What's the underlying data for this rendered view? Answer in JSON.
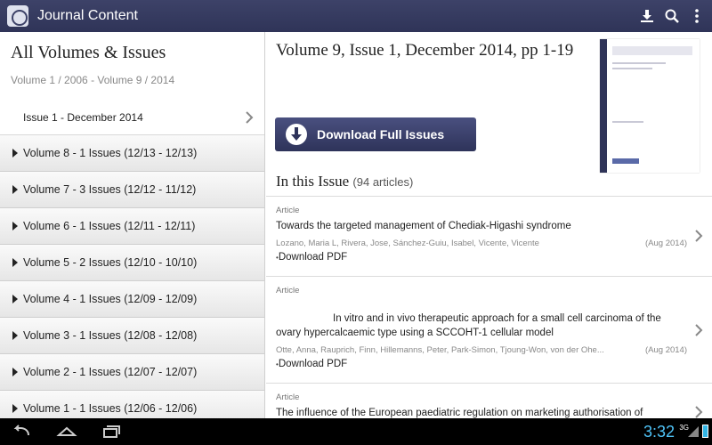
{
  "app": {
    "title": "Journal Content",
    "icons": [
      "app-logo",
      "download-icon",
      "search-icon",
      "overflow-menu-icon"
    ]
  },
  "left": {
    "title": "All Volumes & Issues",
    "range": "Volume 1 / 2006 - Volume 9 / 2014",
    "current_issue": "Issue 1 - December 2014",
    "volumes": [
      "Volume 8 - 1 Issues (12/13  -  12/13)",
      "Volume 7 - 3 Issues (12/12  -  11/12)",
      "Volume 6 - 1 Issues (12/11  -  12/11)",
      "Volume 5 - 2 Issues (12/10  -  10/10)",
      "Volume 4 - 1 Issues (12/09  -  12/09)",
      "Volume 3 - 1 Issues (12/08  -  12/08)",
      "Volume 2 - 1 Issues (12/07  -  12/07)",
      "Volume 1 - 1 Issues (12/06  -  12/06)"
    ]
  },
  "right": {
    "issue_title": "Volume 9, Issue 1, December 2014, pp 1-19",
    "download_label": "Download Full Issues",
    "in_issue_label": "In this Issue",
    "article_count": "(94 articles)",
    "articles": [
      {
        "type": "Article",
        "title": "Towards the targeted management of Chediak-Higashi syndrome",
        "authors": "Lozano, Maria L, Rivera, Jose, Sánchez-Guiu, Isabel, Vicente, Vicente",
        "date": "(Aug 2014)",
        "pdf_label": "Download PDF"
      },
      {
        "type": "Article",
        "title": "In vitro and in vivo therapeutic approach for a small cell carcinoma of the ovary hypercalcaemic type using a SCCOHT-1 cellular model",
        "authors": "Otte, Anna, Rauprich, Finn, Hillemanns, Peter, Park-Simon, Tjoung-Won, von der Ohe...",
        "date": "(Aug 2014)",
        "pdf_label": "Download PDF"
      },
      {
        "type": "Article",
        "title": "The influence of the European paediatric regulation on marketing authorisation of",
        "authors": "",
        "date": "",
        "pdf_label": ""
      }
    ]
  },
  "status": {
    "time": "3:32",
    "network": "3G"
  },
  "colors": {
    "accent": "#3d4268",
    "clock": "#4fc3f7"
  }
}
